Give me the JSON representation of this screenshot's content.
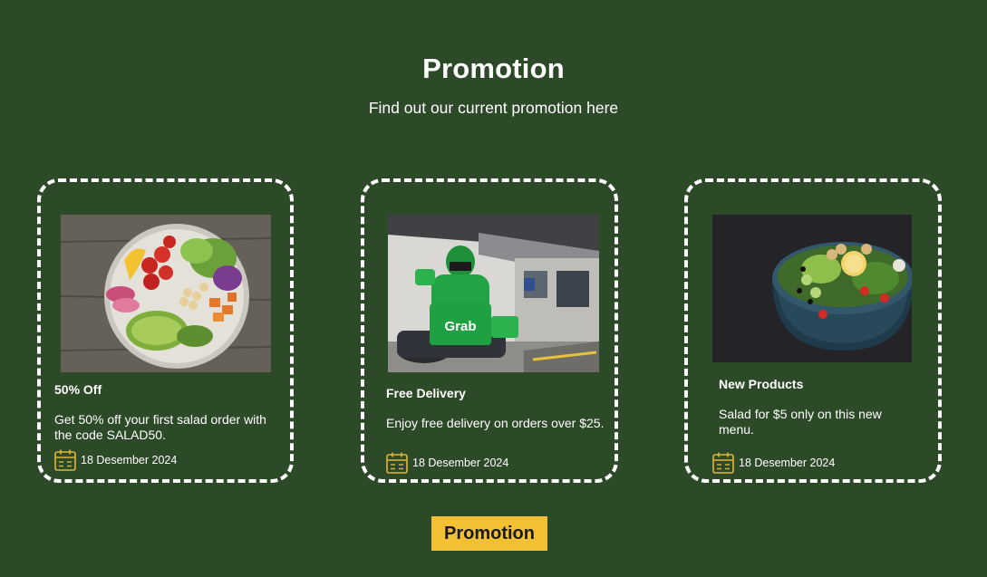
{
  "header": {
    "title": "Promotion",
    "subtitle": "Find out our current promotion here"
  },
  "cards": [
    {
      "title": "50% Off",
      "description": "Get 50% off your first salad order with the code SALAD50.",
      "date": "18 Desember 2024",
      "image": "salad-bowl-photo"
    },
    {
      "title": "Free Delivery",
      "description": "Enjoy free delivery on orders over $25.",
      "date": "18 Desember 2024",
      "image": "delivery-rider-photo",
      "image_text": "Grab"
    },
    {
      "title": "New Products",
      "description": "Salad for $5 only on this new menu.",
      "date": "18 Desember 2024",
      "image": "new-salad-bowl-photo"
    }
  ],
  "promo_button": {
    "label": "Promotion"
  },
  "colors": {
    "background": "#2d4a28",
    "text": "#ffffff",
    "card_border": "#ffffff",
    "accent": "#f3bf33",
    "icon": "#e0b53a"
  }
}
